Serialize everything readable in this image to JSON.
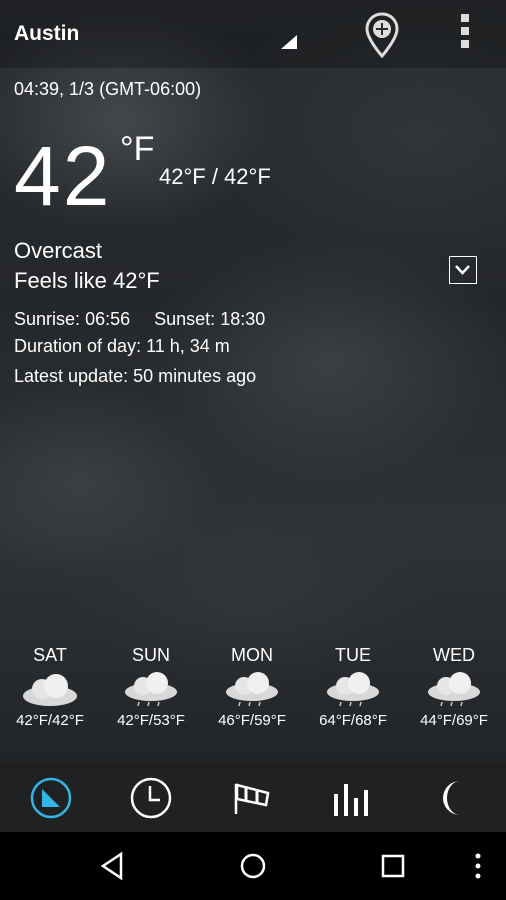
{
  "header": {
    "city": "Austin",
    "icons": {
      "dropdown": "dropdown-triangle-icon",
      "add_location": "add-location-pin-icon",
      "overflow": "overflow-menu-icon"
    }
  },
  "current": {
    "datetime": "04:39, 1/3 (GMT-06:00)",
    "temperature": "42",
    "unit": "°F",
    "high_low": "42°F / 42°F",
    "condition": "Overcast",
    "feels_like": "Feels like 42°F",
    "sunrise_label": "Sunrise:",
    "sunrise": "06:56",
    "sunset_label": "Sunset:",
    "sunset": "18:30",
    "duration": "Duration of day: 11 h, 34 m",
    "latest_update": "Latest update: 50 minutes ago"
  },
  "forecast": [
    {
      "day": "SAT",
      "range": "42°F/42°F",
      "icon": "overcast-cloud-icon"
    },
    {
      "day": "SUN",
      "range": "42°F/53°F",
      "icon": "rain-cloud-icon"
    },
    {
      "day": "MON",
      "range": "46°F/59°F",
      "icon": "rain-cloud-icon"
    },
    {
      "day": "TUE",
      "range": "64°F/68°F",
      "icon": "rain-cloud-icon"
    },
    {
      "day": "WED",
      "range": "44°F/69°F",
      "icon": "rain-cloud-icon"
    }
  ],
  "bottom_nav": [
    {
      "name": "current-tab-icon",
      "active": true
    },
    {
      "name": "hourly-clock-icon",
      "active": false
    },
    {
      "name": "wind-windsock-icon",
      "active": false
    },
    {
      "name": "charts-bars-icon",
      "active": false
    },
    {
      "name": "moon-phase-icon",
      "active": false
    }
  ],
  "colors": {
    "accent": "#33b5e5",
    "text": "#ffffff",
    "nav_bg": "#1f2123"
  }
}
